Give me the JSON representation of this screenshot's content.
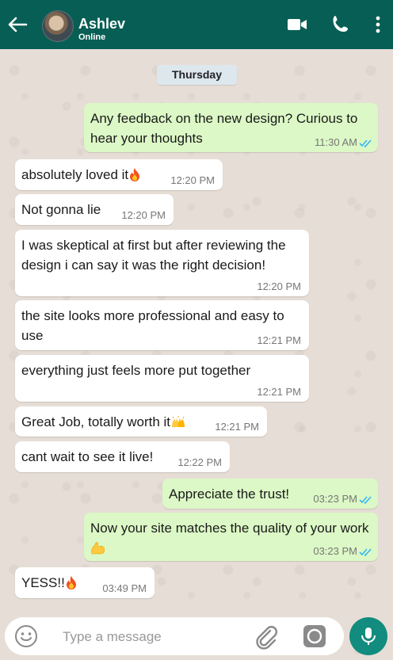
{
  "header": {
    "contact_name": "Ashlev",
    "contact_status": "Online"
  },
  "day_label": "Thursday",
  "messages": [
    {
      "direction": "outgoing",
      "text": "Any feedback on the new design? Curious to hear your thoughts",
      "time": "11:30 AM",
      "read": true
    },
    {
      "direction": "incoming",
      "text": "absolutely loved it",
      "emoji": "fire",
      "time": "12:20 PM"
    },
    {
      "direction": "incoming",
      "text": "Not gonna lie",
      "time": "12:20 PM"
    },
    {
      "direction": "incoming",
      "text": "I was skeptical at first but after reviewing the design i can say it was the right decision!",
      "time": "12:20 PM"
    },
    {
      "direction": "incoming",
      "text": "the site looks more professional and easy to use",
      "time": "12:21 PM"
    },
    {
      "direction": "incoming",
      "text": "everything just feels more put together",
      "time": "12:21 PM"
    },
    {
      "direction": "incoming",
      "text": "Great Job, totally worth it",
      "emoji": "raising-hands",
      "time": "12:21 PM"
    },
    {
      "direction": "incoming",
      "text": "cant wait to see it live!",
      "time": "12:22 PM"
    },
    {
      "direction": "outgoing",
      "text": "Appreciate the trust!",
      "time": "03:23 PM",
      "read": true
    },
    {
      "direction": "outgoing",
      "text": "Now your site matches the quality of your work",
      "emoji": "flexed-biceps",
      "time": "03:23 PM",
      "read": true
    },
    {
      "direction": "incoming",
      "text": "YESS!!",
      "emoji": "fire",
      "time": "03:49 PM"
    }
  ],
  "composer": {
    "placeholder": "Type a message"
  },
  "colors": {
    "header": "#075e54",
    "outgoing_bubble": "#dcf8c6",
    "incoming_bubble": "#ffffff",
    "read_ticks": "#34b7f1",
    "mic_button": "#128c7e"
  }
}
